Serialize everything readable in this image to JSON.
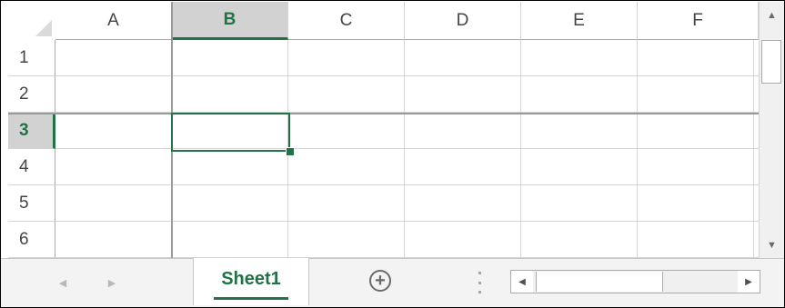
{
  "columns": [
    "A",
    "B",
    "C",
    "D",
    "E",
    "F"
  ],
  "rows": [
    "1",
    "2",
    "3",
    "4",
    "5",
    "6"
  ],
  "selected_column": "B",
  "selected_row": "3",
  "active_sheet": "Sheet1",
  "icons": {
    "scroll_up": "▲",
    "scroll_down": "▼",
    "scroll_left": "◀",
    "scroll_right": "▶",
    "prev_sheet": "◀",
    "next_sheet": "▶",
    "add_sheet": "+"
  },
  "colors": {
    "accent": "#217346",
    "gridline": "#d4d4d4",
    "header_selected_bg": "#d2d2d2"
  }
}
